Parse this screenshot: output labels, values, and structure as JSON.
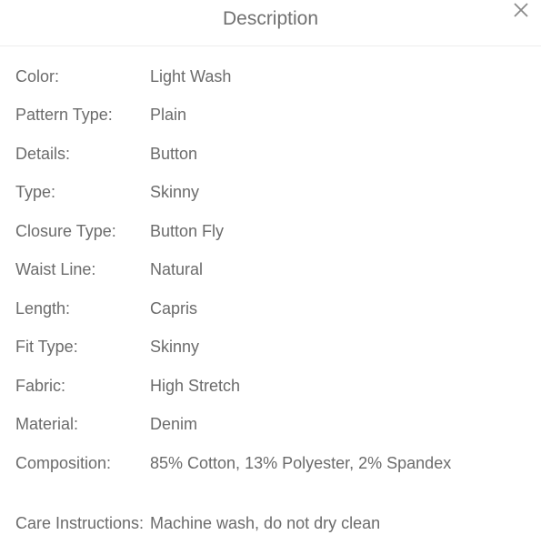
{
  "header": {
    "title": "Description",
    "close_icon": "close-x-icon"
  },
  "attributes": [
    {
      "label": "Color:",
      "value": "Light Wash"
    },
    {
      "label": "Pattern Type:",
      "value": "Plain"
    },
    {
      "label": "Details:",
      "value": "Button"
    },
    {
      "label": "Type:",
      "value": "Skinny"
    },
    {
      "label": "Closure Type:",
      "value": "Button Fly"
    },
    {
      "label": "Waist Line:",
      "value": "Natural"
    },
    {
      "label": "Length:",
      "value": "Capris"
    },
    {
      "label": "Fit Type:",
      "value": "Skinny"
    },
    {
      "label": "Fabric:",
      "value": "High Stretch"
    },
    {
      "label": "Material:",
      "value": "Denim"
    },
    {
      "label": "Composition:",
      "value": "85% Cotton, 13% Polyester, 2% Spandex"
    },
    {
      "label": "Care Instructions:",
      "value": "Machine wash, do not dry clean"
    }
  ]
}
